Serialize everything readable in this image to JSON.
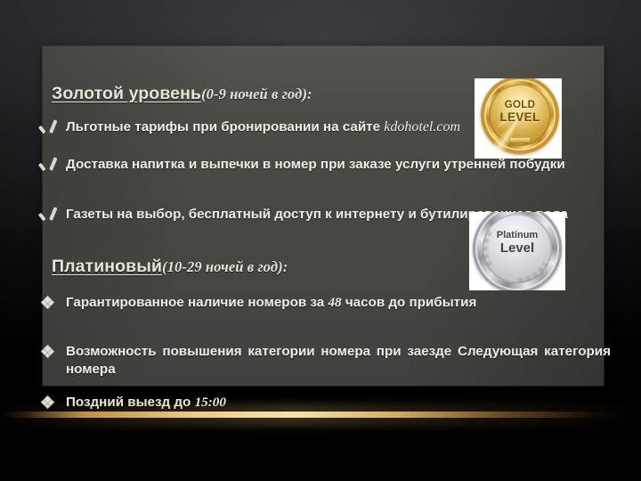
{
  "slide": {
    "colors": {
      "background": "#1c1c20",
      "panel": "#4a4a45",
      "heading_text": "#e7e5d6",
      "body_text": "#efeee4",
      "gold_accent": "#f6d48c",
      "bullet_marker": "#ded",
      "gold_medal": "#d2a53c",
      "platinum_medal": "#c3c6cb"
    },
    "sections": [
      {
        "id": "gold-level",
        "heading": {
          "main": "Золотой уровень",
          "qualifier": "(0-9 ночей в год):"
        },
        "marker": "check-icon",
        "bullets": [
          {
            "text_before": "Льготные тарифы при бронировании на сайте ",
            "site": "kdohotel.com",
            "text_after": ""
          },
          {
            "text_before": "Доставка напитка и выпечки в номер при заказе услуги утренней побудки",
            "site": "",
            "text_after": ""
          },
          {
            "text_before": " Газеты на выбор, бесплатный доступ к интернету и бутилированная вода",
            "site": "",
            "text_after": ""
          }
        ],
        "badge": {
          "name": "gold-level-medal",
          "line1": "GOLD",
          "line2": "LEVEL"
        }
      },
      {
        "id": "platinum-level",
        "heading": {
          "main": "Платиновый",
          "qualifier": "(10-29 ночей в год):"
        },
        "marker": "diamond-icon",
        "bullets": [
          {
            "text_before": "Гарантированное наличие номеров за ",
            "number": "48",
            "text_after": " часов до прибытия"
          },
          {
            "text_before": "Возможность повышения категории номера при заезде Следующая категория номера",
            "number": "",
            "text_after": ""
          },
          {
            "text_before": " Поздний выезд до ",
            "number": "15:00",
            "text_after": ""
          }
        ],
        "badge": {
          "name": "platinum-level-medal",
          "line1": "Platinum",
          "line2": "Level"
        }
      }
    ]
  }
}
